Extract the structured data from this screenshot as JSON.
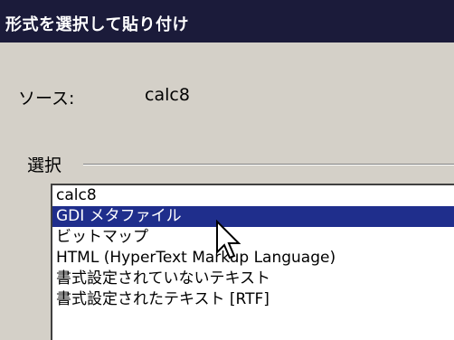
{
  "dialog": {
    "title": "形式を選択して貼り付け"
  },
  "source": {
    "label": "ソース:",
    "value": "calc8"
  },
  "selection": {
    "label": "選択",
    "items": [
      {
        "label": "calc8",
        "selected": false
      },
      {
        "label": "GDI メタファイル",
        "selected": true
      },
      {
        "label": "ビットマップ",
        "selected": false
      },
      {
        "label": "HTML (HyperText Markup Language)",
        "selected": false
      },
      {
        "label": "書式設定されていないテキスト",
        "selected": false
      },
      {
        "label": "書式設定されたテキスト [RTF]",
        "selected": false
      }
    ]
  },
  "colors": {
    "titlebar": "#1b1b3a",
    "selection_highlight": "#1f2e8c",
    "dialog_background": "#d4d0c8"
  },
  "icons": {
    "cursor": "mouse-pointer-icon"
  }
}
